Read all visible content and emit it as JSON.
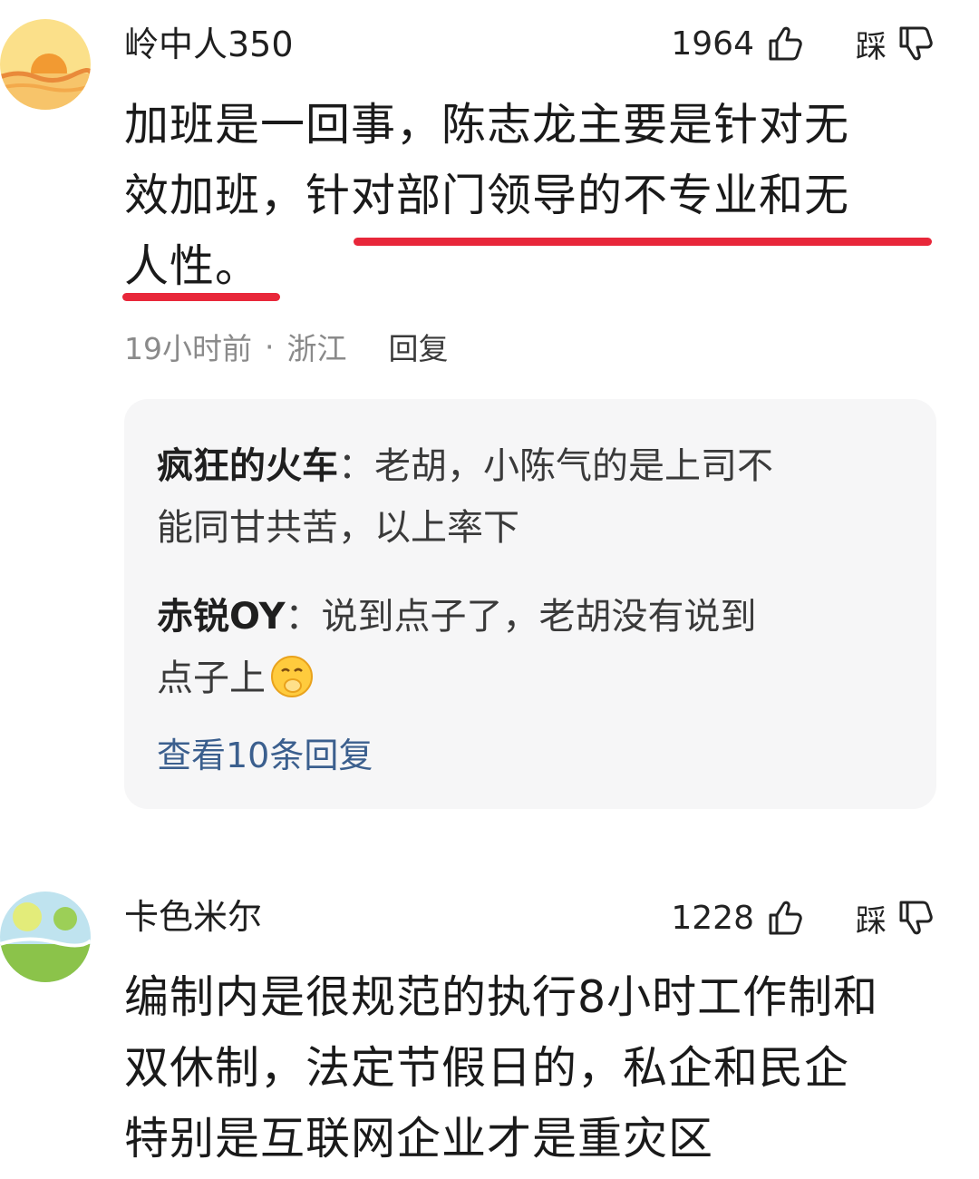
{
  "comments": [
    {
      "username": "岭中人350",
      "likes": "1964",
      "dislike_label": "踩",
      "text_lines": [
        "加班是一回事，陈志龙主要是针对无",
        "效加班，针对部门领导的不专业和无",
        "人性。"
      ],
      "time": "19小时前",
      "separator": "·",
      "location": "浙江",
      "reply_label": "回复",
      "avatar_icon": "sunset-avatar-icon"
    },
    {
      "username": "卡色米尔",
      "likes": "1228",
      "dislike_label": "踩",
      "text_lines": [
        "编制内是很规范的执行8小时工作制和",
        "双休制，法定节假日的，私企和民企",
        "特别是互联网企业才是重灾区"
      ],
      "avatar_icon": "landscape-avatar-icon"
    }
  ],
  "replies": [
    {
      "name": "疯狂的火车",
      "colon": "：",
      "lines": [
        "老胡，小陈气的是上司不",
        "能同甘共苦，以上率下"
      ]
    },
    {
      "name": "赤锐OY",
      "colon": "：",
      "lines": [
        "说到点子了，老胡没有说到",
        "点子上"
      ],
      "emoji": "covering-mouth-emoji-icon"
    }
  ],
  "view_more": "查看10条回复",
  "colors": {
    "underline": "#e8273a",
    "link": "#3b5f8e",
    "reply_bg": "#f6f6f7"
  }
}
